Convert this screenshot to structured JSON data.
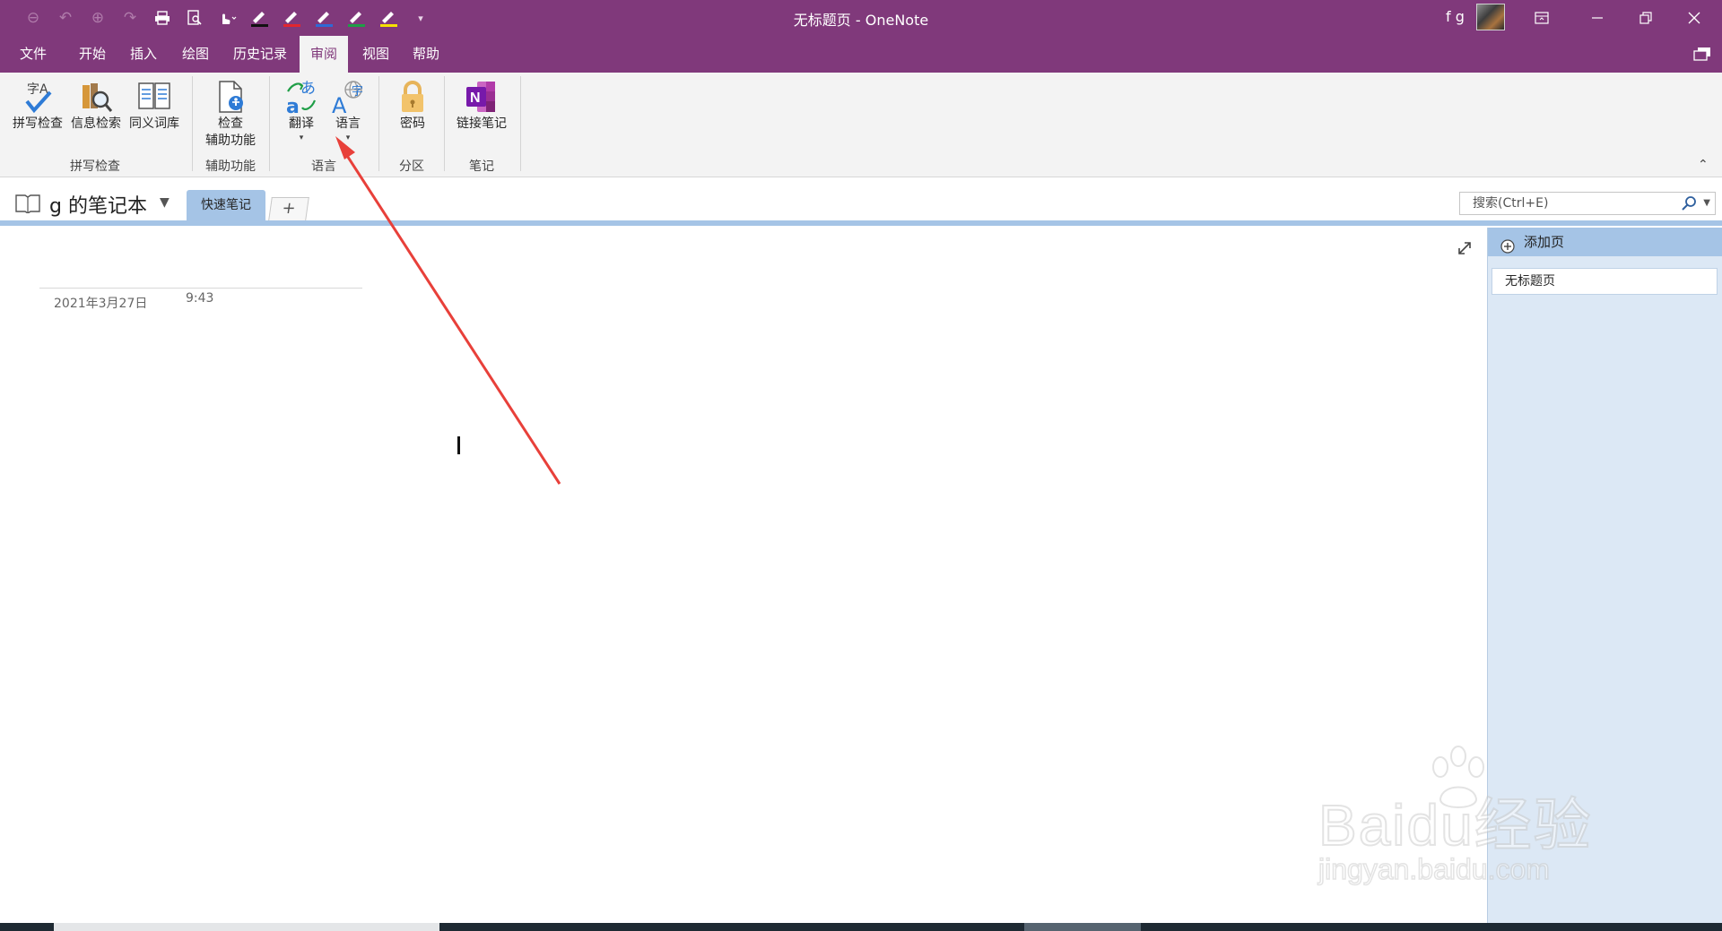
{
  "window": {
    "title": "无标题页 - OneNote",
    "user": "f g",
    "controls": [
      "ribbon-display",
      "restore",
      "close"
    ]
  },
  "menu": {
    "tabs": [
      "文件",
      "开始",
      "插入",
      "绘图",
      "历史记录",
      "审阅",
      "视图",
      "帮助"
    ],
    "active": "审阅"
  },
  "ribbon": {
    "buttons": {
      "spell_check": "拼写检查",
      "research": "信息检索",
      "thesaurus": "同义词库",
      "check_accessibility": "检查\n辅助功能",
      "translate": "翻译",
      "language": "语言",
      "password": "密码",
      "linked_notes": "链接笔记"
    },
    "groups": {
      "spelling": "拼写检查",
      "accessibility": "辅助功能",
      "language": "语言",
      "section": "分区",
      "notes": "笔记"
    }
  },
  "notebook": {
    "name": "g 的笔记本",
    "section_tab": "快速笔记",
    "add_section": "+"
  },
  "search": {
    "placeholder": "搜索(Ctrl+E)"
  },
  "page": {
    "date": "2021年3月27日",
    "time": "9:43"
  },
  "page_list": {
    "add_page": "添加页",
    "pages": [
      "无标题页"
    ]
  },
  "watermark": {
    "brand": "Baidu经验",
    "url": "jingyan.baidu.com"
  },
  "colors": {
    "accent": "#80397b",
    "section_tab": "#a5c4e6",
    "page_pane": "#dce8f5",
    "annotation_arrow": "#e8403a"
  }
}
